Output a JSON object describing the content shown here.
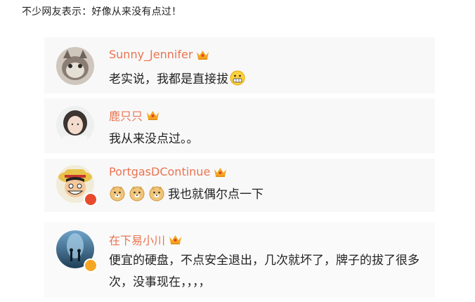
{
  "intro": "不少网友表示：好像从来没有点过！",
  "comments": [
    {
      "name": "Sunny_Jennifer",
      "text": "老实说，我都是直接拔",
      "avatar": "cat-avatar",
      "badge": "crown-badge-icon",
      "trail_emoji": "grin-emoji-icon"
    },
    {
      "name": "鹿只只",
      "text": "我从来没点过。。",
      "avatar": "girl-avatar",
      "badge": "crown-badge-icon"
    },
    {
      "name": "PortgasDContinue",
      "text": "我也就偶尔点一下",
      "avatar": "luffy-avatar",
      "badge": "crown-badge-icon",
      "lead_emojis": [
        "doge-emoji-icon",
        "doge-emoji-icon",
        "doge-emoji-icon"
      ]
    },
    {
      "name": "在下易小川",
      "text": "便宜的硬盘，不点安全退出，几次就坏了，牌子的拔了很多次，没事现在，，，，",
      "avatar": "cave-avatar",
      "badge": "crown-badge-icon"
    }
  ],
  "colors": {
    "name": "#eb7350",
    "text": "#222222",
    "card_bg": "#f8f8f8",
    "crown": "#f5a623",
    "verified": "#f5a623"
  }
}
